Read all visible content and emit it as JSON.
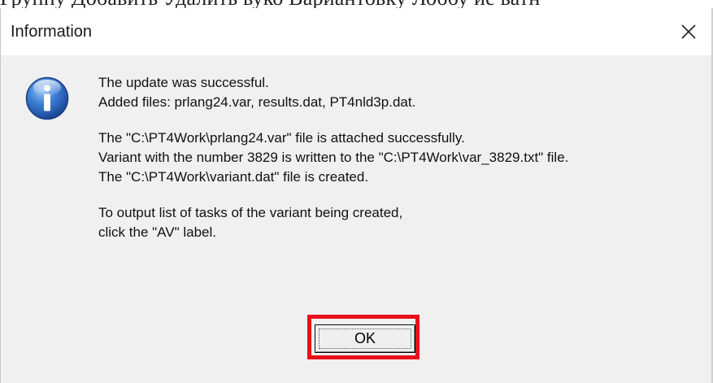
{
  "top_strip": {
    "text": "Группу Добавить Удалить вуко Вариантовку Лоббу ие ватн"
  },
  "dialog": {
    "title": "Information",
    "close_icon": "close-icon",
    "icon": "information-icon",
    "message_lines": [
      "The update was successful.",
      "Added files: prlang24.var, results.dat, PT4nld3p.dat.",
      "",
      "The \"C:\\PT4Work\\prlang24.var\" file is attached successfully.",
      "Variant with the number 3829 is written to the \"C:\\PT4Work\\var_3829.txt\" file.",
      "The \"C:\\PT4Work\\variant.dat\" file is created.",
      "",
      "To output list of tasks of the variant being created,",
      "click the \"AV\" label."
    ],
    "ok_label": "OK"
  },
  "colors": {
    "dialog_bg": "#f0f0f0",
    "titlebar_bg": "#ffffff",
    "highlight": "#e8101c",
    "icon_blue": "#1f5fbf"
  }
}
